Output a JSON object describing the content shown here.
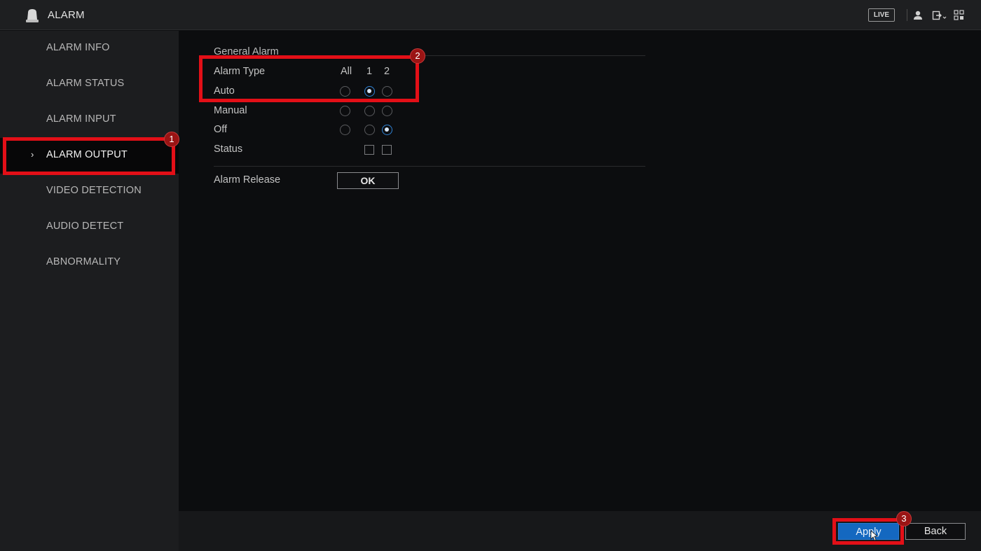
{
  "app": {
    "title": "ALARM",
    "icon": "alarm-bell-icon",
    "live_label": "LIVE",
    "toolbar_icons": [
      "user-icon",
      "logout-icon",
      "grid-menu-icon"
    ]
  },
  "sidebar": {
    "items": [
      {
        "label": "ALARM INFO",
        "active": false
      },
      {
        "label": "ALARM STATUS",
        "active": false
      },
      {
        "label": "ALARM INPUT",
        "active": false
      },
      {
        "label": "ALARM OUTPUT",
        "active": true,
        "icon": "chevron-right-icon",
        "chevron": "›"
      },
      {
        "label": "VIDEO DETECTION",
        "active": false
      },
      {
        "label": "AUDIO DETECT",
        "active": false
      },
      {
        "label": "ABNORMALITY",
        "active": false
      }
    ]
  },
  "general_alarm": {
    "section_title": "General Alarm",
    "header_label": "Alarm Type",
    "columns": [
      "All",
      "1",
      "2"
    ],
    "rows": [
      {
        "label": "Auto",
        "selected": [
          false,
          true,
          false
        ]
      },
      {
        "label": "Manual",
        "selected": [
          false,
          false,
          false
        ]
      },
      {
        "label": "Off",
        "selected": [
          false,
          false,
          true
        ]
      }
    ],
    "status_label": "Status",
    "status_checks": [
      false,
      false
    ]
  },
  "alarm_release": {
    "label": "Alarm Release",
    "button_label": "OK"
  },
  "footer": {
    "apply_label": "Apply",
    "back_label": "Back"
  },
  "annotations": [
    {
      "number": "1"
    },
    {
      "number": "2"
    },
    {
      "number": "3"
    }
  ],
  "colors": {
    "accent": "#1468c0",
    "highlight": "#e30f17",
    "badge": "#9a1414"
  }
}
